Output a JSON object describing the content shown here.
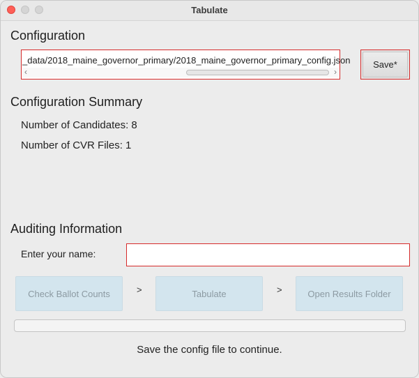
{
  "window": {
    "title": "Tabulate"
  },
  "configuration": {
    "heading": "Configuration",
    "path_value": "_data/2018_maine_governor_primary/2018_maine_governor_primary_config.json",
    "save_label": "Save*"
  },
  "summary": {
    "heading": "Configuration Summary",
    "candidates": "Number of Candidates: 8",
    "cvr_files": "Number of CVR Files: 1"
  },
  "auditing": {
    "heading": "Auditing Information",
    "name_label": "Enter your name:",
    "name_value": ""
  },
  "steps": {
    "check_label": "Check Ballot Counts",
    "separator": ">",
    "tabulate_label": "Tabulate",
    "open_label": "Open Results Folder"
  },
  "progress": {
    "value": 0
  },
  "status": {
    "message": "Save the config file to continue."
  },
  "colors": {
    "error_border": "#d62a2a",
    "disabled_button": "#d3e5ee",
    "close_button": "#fe5f57"
  }
}
